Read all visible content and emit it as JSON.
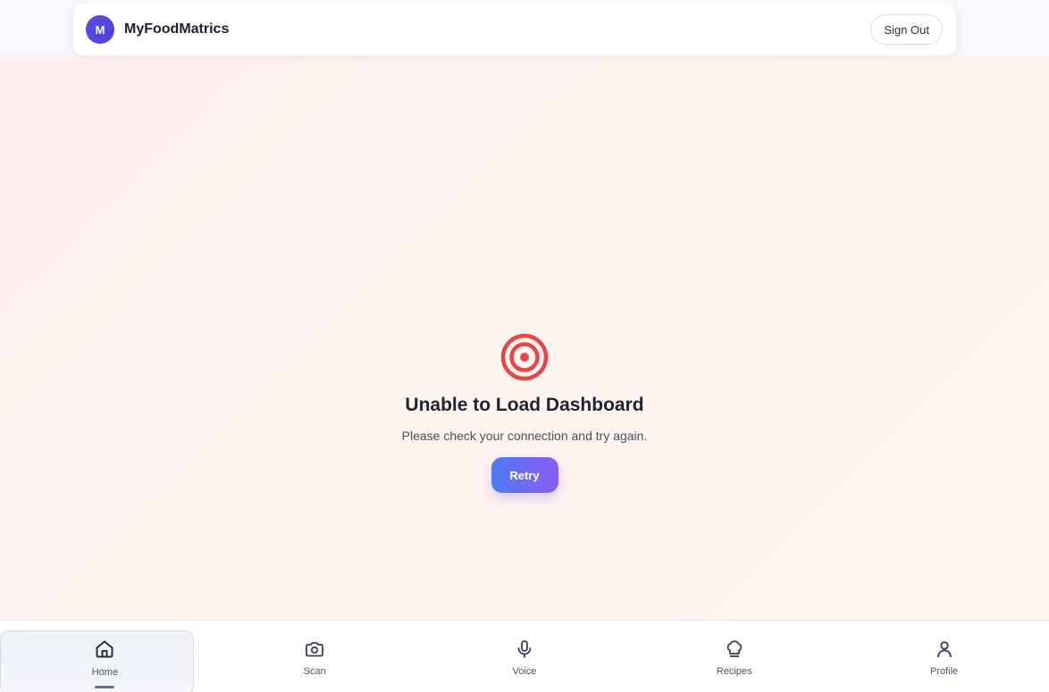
{
  "header": {
    "logo_letter": "M",
    "app_title": "MyFoodMatrics",
    "sign_out_label": "Sign Out"
  },
  "error": {
    "icon": "target-icon",
    "title": "Unable to Load Dashboard",
    "message": "Please check your connection and try again.",
    "retry_label": "Retry",
    "icon_color": "#e84545"
  },
  "nav": {
    "items": [
      {
        "label": "Home",
        "icon": "home-icon",
        "active": true
      },
      {
        "label": "Scan",
        "icon": "camera-icon",
        "active": false
      },
      {
        "label": "Voice",
        "icon": "microphone-icon",
        "active": false
      },
      {
        "label": "Recipes",
        "icon": "chef-hat-icon",
        "active": false
      },
      {
        "label": "Profile",
        "icon": "user-icon",
        "active": false
      }
    ]
  },
  "colors": {
    "brand": "#5047e0",
    "retry_gradient_start": "#4f7cf5",
    "retry_gradient_end": "#8b5cf0"
  }
}
